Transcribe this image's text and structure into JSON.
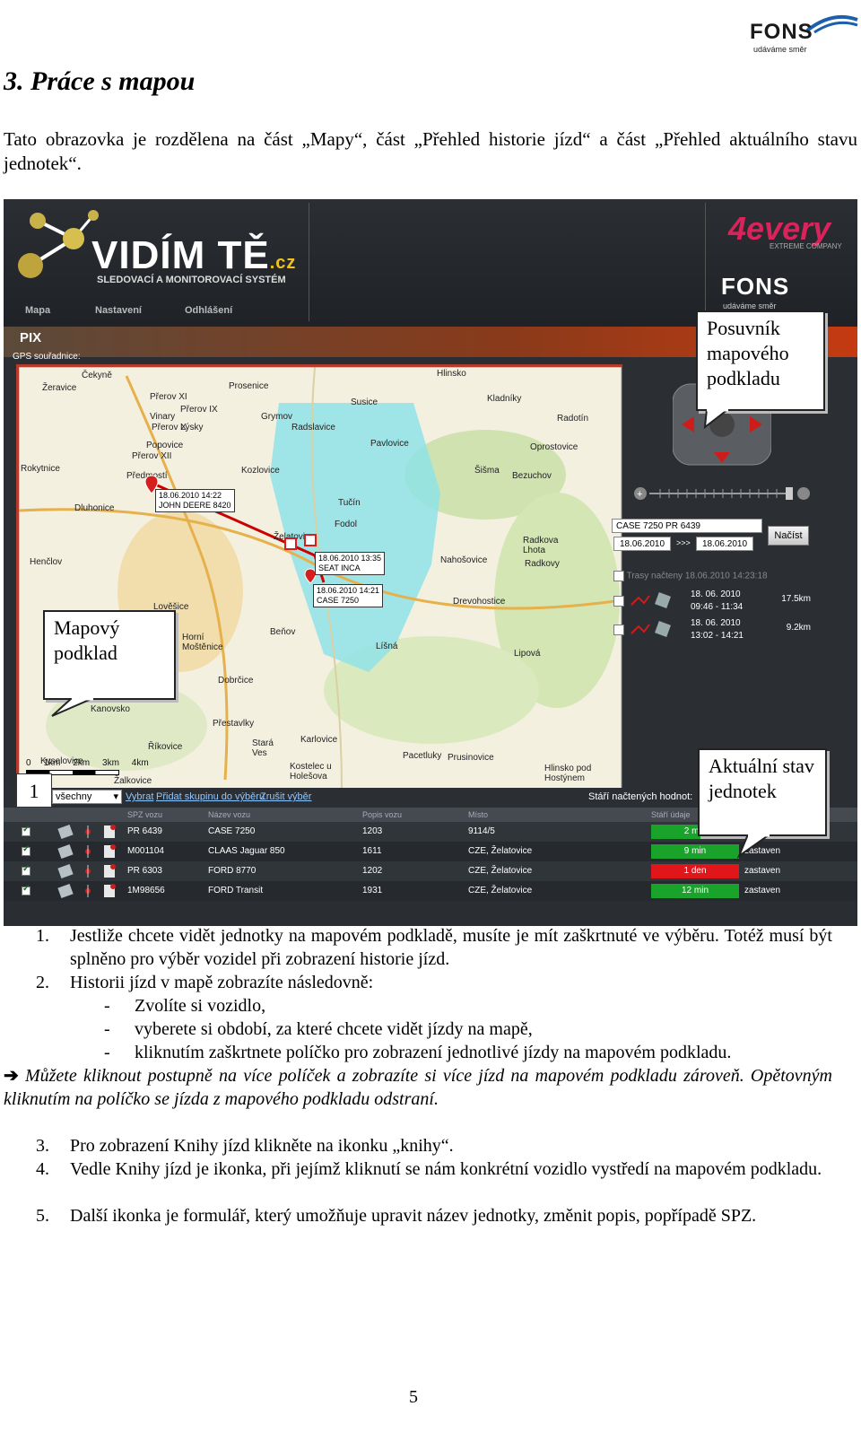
{
  "logo": {
    "word": "FONS",
    "slogan": "udáváme směr"
  },
  "section_title": "3. Práce s mapou",
  "intro": "Tato obrazovka je rozdělena na část „Mapy“, část „Přehled historie jízd“ a část „Přehled aktuálního stavu jednotek“.",
  "screenshot": {
    "brand": "VIDÍM TĚ",
    "brand_suffix": ".cz",
    "brand_sub": "SLEDOVACÍ A MONITOROVACÍ SYSTÉM",
    "nav": [
      "Mapa",
      "Nastavení",
      "Odhlášení"
    ],
    "partner": {
      "name": "4every",
      "sub": "EXTREME COMPANY",
      "fons": "FONS",
      "fons_sub": "udáváme směr"
    },
    "pix_label": "PIX",
    "gps_label": "GPS souřadnice:",
    "map_places": [
      {
        "t": "Čekyně"
      },
      {
        "t": "Žeravice"
      },
      {
        "t": "Prosenice"
      },
      {
        "t": "Přerov XI"
      },
      {
        "t": "Vinary"
      },
      {
        "t": "Přerov IX"
      },
      {
        "t": "Přerov X"
      },
      {
        "t": "Lýsky"
      },
      {
        "t": "Popovice"
      },
      {
        "t": "Přerov XII"
      },
      {
        "t": "Předmostí"
      },
      {
        "t": "Rokytnice"
      },
      {
        "t": "Dluhonice"
      },
      {
        "t": "Grymov"
      },
      {
        "t": "Radslavice"
      },
      {
        "t": "Kozlovice"
      },
      {
        "t": "Hlinsko"
      },
      {
        "t": "Susice"
      },
      {
        "t": "Kladníky"
      },
      {
        "t": "Radotín"
      },
      {
        "t": "Oprostovice"
      },
      {
        "t": "Pavlovice"
      },
      {
        "t": "Šišma"
      },
      {
        "t": "Bezuchov"
      },
      {
        "t": "Henčlov"
      },
      {
        "t": "Radkova Lhota"
      },
      {
        "t": "Radkovy"
      },
      {
        "t": "Nahošovice"
      },
      {
        "t": "Tučín"
      },
      {
        "t": "Fodol"
      },
      {
        "t": "Želatovice"
      },
      {
        "t": "Lověšice"
      },
      {
        "t": "Horní Moštěnice"
      },
      {
        "t": "Dobrčice"
      },
      {
        "t": "Beňov"
      },
      {
        "t": "Lipová"
      },
      {
        "t": "Kanovsko"
      },
      {
        "t": "Přestavlky"
      },
      {
        "t": "Říkovice"
      },
      {
        "t": "Stará Ves"
      },
      {
        "t": "Karlovice"
      },
      {
        "t": "Pacetluky"
      },
      {
        "t": "Prusinovice"
      },
      {
        "t": "Kostelec u Holešova"
      },
      {
        "t": "Hlinsko pod Hostýnem"
      },
      {
        "t": "Kyselovice"
      },
      {
        "t": "Žalkovice"
      },
      {
        "t": "Drevohostice"
      },
      {
        "t": "Líšná"
      }
    ],
    "popups": [
      {
        "date": "18.06.2010 14:22",
        "name": "JOHN DEERE 8420"
      },
      {
        "date": "18.06.2010 13:35",
        "name": "SEAT INCA"
      },
      {
        "date": "18.06.2010 14:21",
        "name": "CASE 7250"
      }
    ],
    "scale": "0     1km     2km     3km     4km",
    "vehicle_select": "CASE 7250 PR 6439",
    "date_from": "18.06.2010",
    "date_arrows": ">>>",
    "date_to": "18.06.2010",
    "load_button": "Načíst",
    "trips_loaded": "Trasy načteny 18.06.2010 14:23:18",
    "trips": [
      {
        "date": "18. 06. 2010",
        "time": "09:46 - 11:34",
        "km": "17.5km"
      },
      {
        "date": "18. 06. 2010",
        "time": "13:02 - 14:21",
        "km": "9.2km"
      }
    ],
    "table": {
      "filter_value": "všechny",
      "links": [
        "Vybrat",
        "Přidat skupinu do výběru",
        "Zrušit výběr"
      ],
      "staleness": "Stáří načtených hodnot:",
      "headers": [
        "SPZ vozu",
        "Název vozu",
        "Popis vozu",
        "Místo",
        "Stáří údaje"
      ],
      "rows": [
        {
          "spz": "PR 6439",
          "name": "CASE 7250",
          "desc": "1203",
          "place": "9114/5",
          "age": "2 min",
          "state": "",
          "color": "#1aa32a"
        },
        {
          "spz": "M001104",
          "name": "CLAAS Jaguar 850",
          "desc": "1611",
          "place": "CZE, Želatovice",
          "age": "9 min",
          "state": "zastaven",
          "color": "#1aa32a"
        },
        {
          "spz": "PR 6303",
          "name": "FORD 8770",
          "desc": "1202",
          "place": "CZE, Želatovice",
          "age": "1 den",
          "state": "zastaven",
          "color": "#e0161b"
        },
        {
          "spz": "1M98656",
          "name": "FORD Transit",
          "desc": "1931",
          "place": "CZE, Želatovice",
          "age": "12 min",
          "state": "zastaven",
          "color": "#1aa32a"
        }
      ]
    }
  },
  "callouts": {
    "posuvnik": "Posuvník mapového podkladu",
    "mapovy": "Mapový podklad",
    "aktualni": "Aktuální stav jednotek",
    "number": "1"
  },
  "instructions": {
    "item1_num": "1.",
    "item1": "Jestliže chcete vidět jednotky na mapovém podkladě, musíte je mít zaškrtnuté ve výběru. Totéž musí být splněno pro výběr vozidel při zobrazení historie jízd.",
    "item2_num": "2.",
    "item2": "Historii jízd v mapě zobrazíte následovně:",
    "sub1": "Zvolíte si vozidlo,",
    "sub2": "vyberete si období, za které chcete vidět jízdy na mapě,",
    "sub3": "kliknutím zaškrtnete políčko pro zobrazení jednotlivé jízdy na mapovém podkladu.",
    "dash": "-",
    "arrow": "➔",
    "note": "Můžete kliknout postupně na více políček a zobrazíte si více jízd na mapovém podkladu zároveň. Opětovným kliknutím na políčko se jízda z mapového podkladu odstraní.",
    "item3_num": "3.",
    "item3": "Pro zobrazení Knihy jízd klikněte na ikonku „knihy“.",
    "item4_num": "4.",
    "item4": "Vedle Knihy jízd je ikonka, při jejímž kliknutí se nám konkrétní vozidlo vystředí na mapovém podkladu.",
    "item5_num": "5.",
    "item5": "Další ikonka je formulář, který umožňuje upravit název jednotky, změnit popis, popřípadě SPZ."
  },
  "page_number": "5"
}
